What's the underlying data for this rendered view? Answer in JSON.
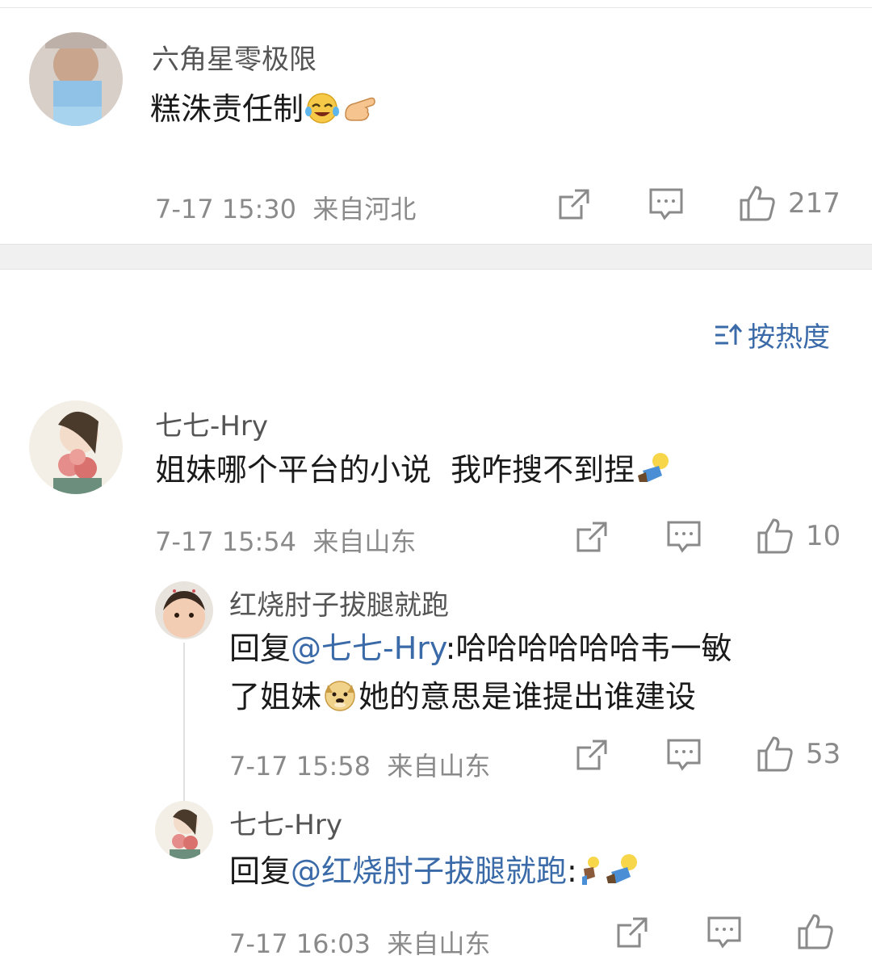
{
  "comments": [
    {
      "username": "六角星零极限",
      "text": "糕洙责任制",
      "emojis": [
        "laughing-crying-emoji",
        "pointing-hand-emoji"
      ],
      "time": "7-17 15:30",
      "location": "来自河北",
      "likes": "217"
    }
  ],
  "sort": {
    "label": "按热度"
  },
  "thread": [
    {
      "username": "七七-Hry",
      "text": "姐妹哪个平台的小说  我咋搜不到捏",
      "emojis": [
        "doll-emoji"
      ],
      "time": "7-17 15:54",
      "location": "来自山东",
      "likes": "10"
    },
    {
      "username": "红烧肘子拔腿就跑",
      "reply_prefix": "回复",
      "mention": "@七七-Hry",
      "text_line1": ":哈哈哈哈哈哈韦一敏",
      "text_line2a": "了姐妹",
      "text_line2b": "她的意思是谁提出谁建设",
      "emojis": [
        "doge-emoji"
      ],
      "time": "7-17 15:58",
      "location": "来自山东",
      "likes": "53"
    },
    {
      "username": "七七-Hry",
      "reply_prefix": "回复",
      "mention": "@红烧肘子拔腿就跑",
      "colon": ":",
      "emojis": [
        "small-doll-emoji",
        "doll-emoji"
      ],
      "time": "7-17 16:03",
      "location": "来自山东",
      "likes": ""
    }
  ],
  "colors": {
    "mention": "#3a6aa8",
    "meta": "#8a8a8a",
    "divider": "#f0f0f0"
  }
}
